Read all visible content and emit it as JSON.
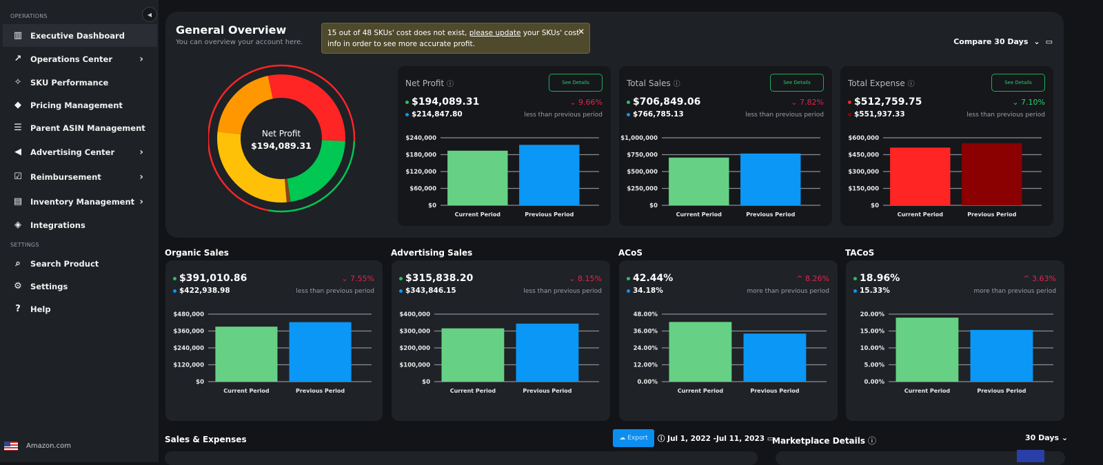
{
  "sidebar": {
    "section_operations": "OPERATIONS",
    "section_settings": "SETTINGS",
    "items": [
      {
        "label": "Executive Dashboard",
        "icon": "bar-chart-icon",
        "active": true
      },
      {
        "label": "Operations Center",
        "icon": "trend-up-icon",
        "chevron": true
      },
      {
        "label": "SKU Performance",
        "icon": "sparkle-chart-icon"
      },
      {
        "label": "Pricing Management",
        "icon": "tag-icon"
      },
      {
        "label": "Parent ASIN Management",
        "icon": "list-icon"
      },
      {
        "label": "Advertising Center",
        "icon": "megaphone-icon",
        "chevron": true
      },
      {
        "label": "Reimbursement",
        "icon": "clipboard-check-icon",
        "chevron": true
      },
      {
        "label": "Inventory Management",
        "icon": "archive-box-icon",
        "chevron": true
      },
      {
        "label": "Integrations",
        "icon": "code-icon"
      }
    ],
    "settings_items": [
      {
        "label": "Search Product",
        "icon": "search-icon"
      },
      {
        "label": "Settings",
        "icon": "gear-icon"
      },
      {
        "label": "Help",
        "icon": "help-icon"
      }
    ],
    "marketplace": "Amazon.com"
  },
  "overview": {
    "title": "General Overview",
    "subtitle": "You can overview your account here.",
    "alert": {
      "pre": "15 out of 48 SKUs' cost does not exist, ",
      "link": "please update",
      "post": " your SKUs' cost info in order to see more accurate profit."
    },
    "compare": "Compare 30 Days",
    "donut": {
      "label": "Net Profit",
      "value": "$194,089.31"
    }
  },
  "colors": {
    "current": "#66d184",
    "previous": "#0a97f5",
    "expense_current": "#ff2525",
    "expense_previous": "#8b0000",
    "up_bad": "#e8234c",
    "good": "#2ed06e"
  },
  "cards": [
    {
      "title": "Net Profit",
      "see": "See Details",
      "current": "$194,089.31",
      "previous": "$214,847.80",
      "change": "9.66%",
      "dir": "down",
      "note": "less than previous period",
      "pct_color": "#e8234c",
      "dot1": "#22c55e",
      "dot2": "#0a97f5"
    },
    {
      "title": "Total Sales",
      "see": "See Details",
      "current": "$706,849.06",
      "previous": "$766,785.13",
      "change": "7.82%",
      "dir": "down",
      "note": "less than previous period",
      "pct_color": "#e8234c",
      "dot1": "#22c55e",
      "dot2": "#0a97f5"
    },
    {
      "title": "Total Expense",
      "see": "See Details",
      "current": "$512,759.75",
      "previous": "$551,937.33",
      "change": "7.10%",
      "dir": "down",
      "note": "less than previous period",
      "pct_color": "#2ed06e",
      "dot1": "#ff2525",
      "dot2": "#8b0000"
    }
  ],
  "lower_cards": [
    {
      "title": "Organic Sales",
      "current": "$391,010.86",
      "previous": "$422,938.98",
      "change": "7.55%",
      "dir": "down",
      "note": "less than previous period"
    },
    {
      "title": "Advertising Sales",
      "current": "$315,838.20",
      "previous": "$343,846.15",
      "change": "8.15%",
      "dir": "down",
      "note": "less than previous period"
    },
    {
      "title": "ACoS",
      "current": "42.44%",
      "previous": "34.18%",
      "change": "8.26%",
      "dir": "up",
      "note": "more than previous period"
    },
    {
      "title": "TACoS",
      "current": "18.96%",
      "previous": "15.33%",
      "change": "3.63%",
      "dir": "up",
      "note": "more than previous period"
    }
  ],
  "chart_data": [
    {
      "type": "pie",
      "title": "Net Profit",
      "center_value": "$194,089.31",
      "segments": [
        {
          "color": "#ff2525",
          "value": 29
        },
        {
          "color": "#00c853",
          "value": 22
        },
        {
          "color": "#8b4513",
          "value": 1
        },
        {
          "color": "#ffc107",
          "value": 28
        },
        {
          "color": "#ff9800",
          "value": 20
        }
      ]
    },
    {
      "type": "bar",
      "categories": [
        "Current Period",
        "Previous Period"
      ],
      "values": [
        194089.31,
        214847.8
      ],
      "yticks": [
        "$0",
        "$60,000",
        "$120,000",
        "$180,000",
        "$240,000"
      ],
      "ylim": [
        0,
        240000
      ],
      "colors": [
        "#66d184",
        "#0a97f5"
      ]
    },
    {
      "type": "bar",
      "categories": [
        "Current Period",
        "Previous Period"
      ],
      "values": [
        706849.06,
        766785.13
      ],
      "yticks": [
        "$0",
        "$250,000",
        "$500,000",
        "$750,000",
        "$1,000,000"
      ],
      "ylim": [
        0,
        1000000
      ],
      "colors": [
        "#66d184",
        "#0a97f5"
      ]
    },
    {
      "type": "bar",
      "categories": [
        "Current Period",
        "Previous Period"
      ],
      "values": [
        512759.75,
        551937.33
      ],
      "yticks": [
        "$0",
        "$150,000",
        "$300,000",
        "$450,000",
        "$600,000"
      ],
      "ylim": [
        0,
        600000
      ],
      "colors": [
        "#ff2525",
        "#8b0000"
      ]
    },
    {
      "type": "bar",
      "categories": [
        "Current Period",
        "Previous Period"
      ],
      "values": [
        391010.86,
        422938.98
      ],
      "yticks": [
        "$0",
        "$120,000",
        "$240,000",
        "$360,000",
        "$480,000"
      ],
      "ylim": [
        0,
        480000
      ],
      "colors": [
        "#66d184",
        "#0a97f5"
      ]
    },
    {
      "type": "bar",
      "categories": [
        "Current Period",
        "Previous Period"
      ],
      "values": [
        315838.2,
        343846.15
      ],
      "yticks": [
        "$0",
        "$100,000",
        "$200,000",
        "$300,000",
        "$400,000"
      ],
      "ylim": [
        0,
        400000
      ],
      "colors": [
        "#66d184",
        "#0a97f5"
      ]
    },
    {
      "type": "bar",
      "categories": [
        "Current Period",
        "Previous Period"
      ],
      "values": [
        42.44,
        34.18
      ],
      "yticks": [
        "0.00%",
        "12.00%",
        "24.00%",
        "36.00%",
        "48.00%"
      ],
      "ylim": [
        0,
        48
      ],
      "colors": [
        "#66d184",
        "#0a97f5"
      ]
    },
    {
      "type": "bar",
      "categories": [
        "Current Period",
        "Previous Period"
      ],
      "values": [
        18.96,
        15.33
      ],
      "yticks": [
        "0.00%",
        "5.00%",
        "10.00%",
        "15.00%",
        "20.00%"
      ],
      "ylim": [
        0,
        20
      ],
      "colors": [
        "#66d184",
        "#0a97f5"
      ]
    }
  ],
  "bottom": {
    "sales_expenses": "Sales & Expenses",
    "export": "Export",
    "date_range": "Jul 1, 2022 -Jul 11, 2023",
    "marketplace_details": "Marketplace Details",
    "days": "30 Days"
  }
}
